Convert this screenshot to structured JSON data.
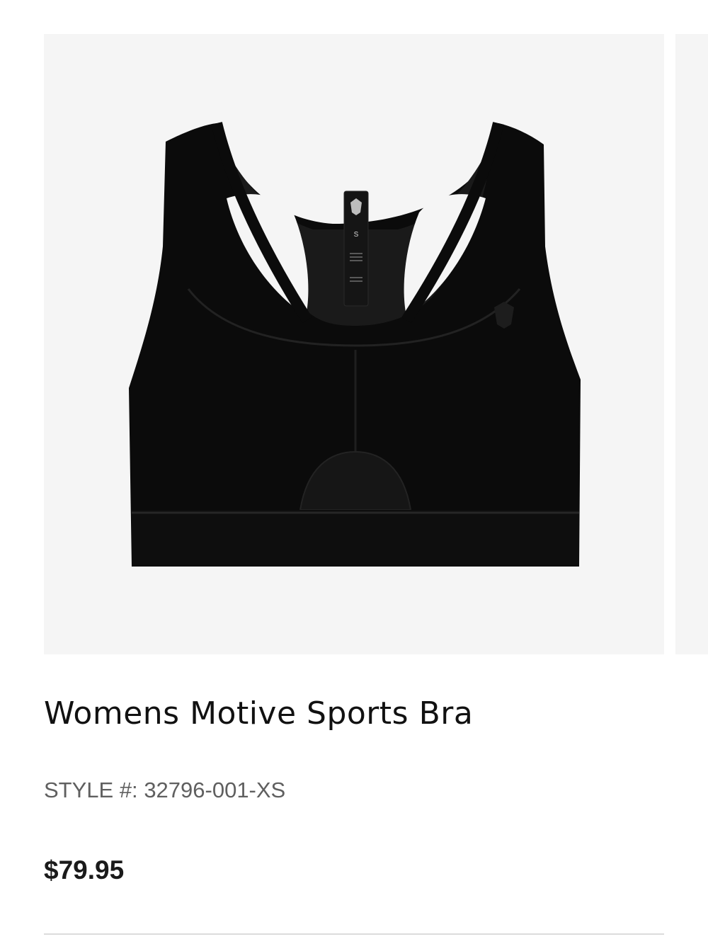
{
  "product": {
    "name": "Womens Motive Sports Bra",
    "style_label": "STYLE #:",
    "style_number": "32796-001-XS",
    "price": "$79.95",
    "tag_size": "S"
  },
  "gallery": {
    "image": "black-racerback-sports-bra",
    "has_next_slide": true
  },
  "colors": {
    "image_background": "#f5f5f5",
    "product": "#0b0b0b",
    "divider": "#dcdcdc"
  }
}
